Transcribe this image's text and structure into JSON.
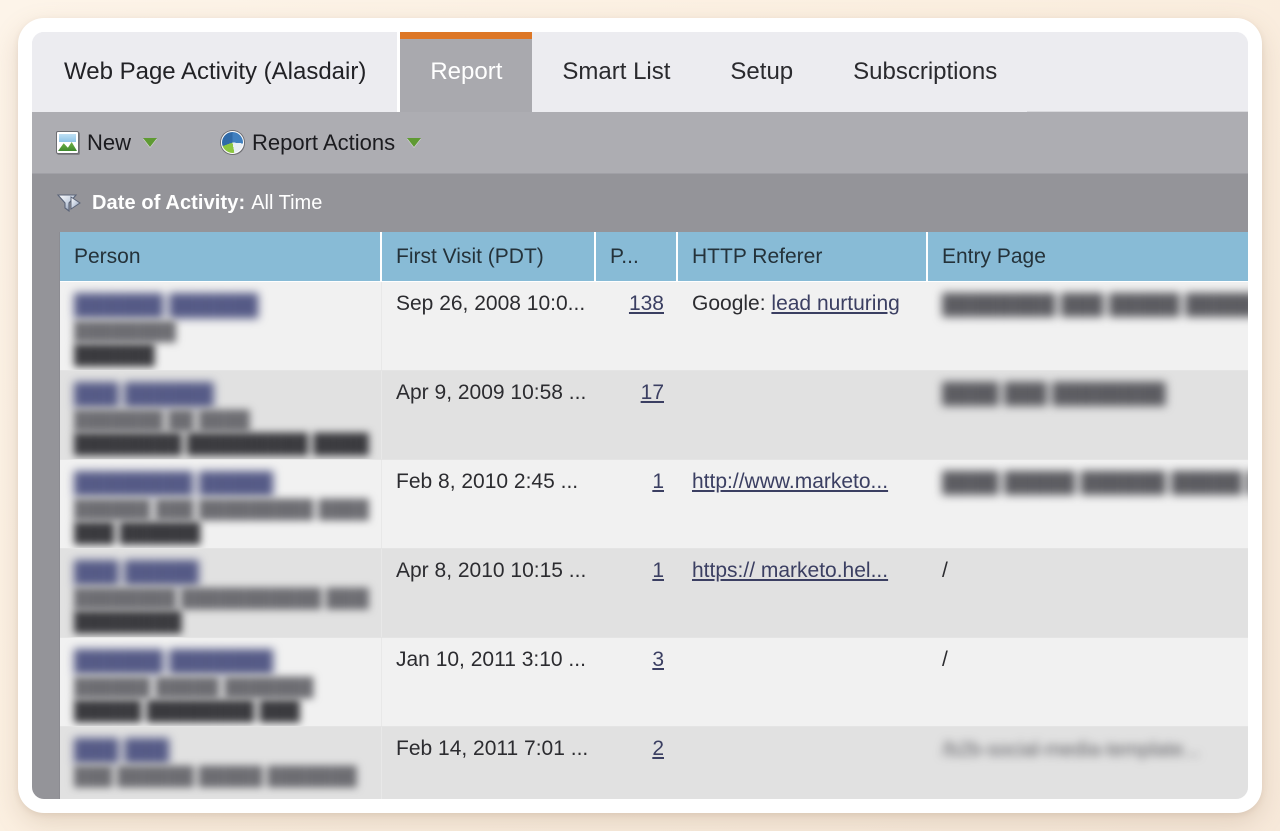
{
  "app": {
    "outer_background": "#fbf0e2",
    "accent_orange": "#dd7726",
    "header_blue": "#88bbd6",
    "link_color": "#3b3f62"
  },
  "tabs": [
    {
      "label": "Web Page Activity (Alasdair)",
      "active": false,
      "is_title": true
    },
    {
      "label": "Report",
      "active": true,
      "is_title": false
    },
    {
      "label": "Smart List",
      "active": false,
      "is_title": false
    },
    {
      "label": "Setup",
      "active": false,
      "is_title": false
    },
    {
      "label": "Subscriptions",
      "active": false,
      "is_title": false
    }
  ],
  "toolbar": {
    "buttons": [
      {
        "label": "New",
        "icon": "new-report-image-icon",
        "has_dropdown": true
      },
      {
        "label": "Report Actions",
        "icon": "pie-chart-icon",
        "has_dropdown": true
      }
    ]
  },
  "filter": {
    "icon": "funnel-filter-icon",
    "label": "Date of Activity:",
    "value": "All Time"
  },
  "grid": {
    "columns": [
      {
        "key": "person",
        "label": "Person"
      },
      {
        "key": "first_visit",
        "label": "First Visit (PDT)"
      },
      {
        "key": "page_views",
        "label": "P..."
      },
      {
        "key": "http_referer",
        "label": "HTTP Referer"
      },
      {
        "key": "entry_page",
        "label": "Entry Page"
      }
    ],
    "rows": [
      {
        "person": {
          "redacted": true,
          "name": "██████ ██████",
          "line2": "████████",
          "line3": "██████"
        },
        "first_visit": "Sep 26, 2008 10:0...",
        "page_views": "138",
        "page_views_link": true,
        "http_referer_prefix": "Google:",
        "http_referer_link": "lead nurturing",
        "entry_page": {
          "redacted": true,
          "text": "████████ ███ █████ █████..."
        }
      },
      {
        "person": {
          "redacted": true,
          "name": "███ ██████",
          "line2": "███████ ██ ████",
          "line3": "████████ █████████ ████████"
        },
        "first_visit": "Apr 9, 2009 10:58 ...",
        "page_views": "17",
        "page_views_link": true,
        "http_referer_prefix": "",
        "http_referer_link": "",
        "entry_page": {
          "redacted": true,
          "text": "████ ███ ████████"
        }
      },
      {
        "person": {
          "redacted": true,
          "name": "████████ █████",
          "line2": "██████ ███ █████████ ███████",
          "line3": "███ ██████"
        },
        "first_visit": "Feb 8, 2010 2:45 ...",
        "page_views": "1",
        "page_views_link": true,
        "http_referer_prefix": "",
        "http_referer_link": "http://www.marketo...",
        "entry_page": {
          "redacted": true,
          "text": "████ █████ ██████ █████ ████..."
        }
      },
      {
        "person": {
          "redacted": true,
          "name": "███ █████",
          "line2": "████████ ███████████ ████████",
          "line3": "████████"
        },
        "first_visit": "Apr 8, 2010 10:15 ...",
        "page_views": "1",
        "page_views_link": true,
        "http_referer_prefix": "",
        "http_referer_link": "https:// marketo.hel...",
        "entry_page": {
          "redacted": false,
          "text": "/"
        }
      },
      {
        "person": {
          "redacted": true,
          "name": "██████ ███████",
          "line2": "██████ █████ ███████",
          "line3": "█████ ████████ ███"
        },
        "first_visit": "Jan 10, 2011 3:10 ...",
        "page_views": "3",
        "page_views_link": true,
        "http_referer_prefix": "",
        "http_referer_link": "",
        "entry_page": {
          "redacted": false,
          "text": "/"
        }
      },
      {
        "person": {
          "redacted": true,
          "name": "███ ███",
          "line2": "███ ██████ █████ ███████",
          "line3": ""
        },
        "first_visit": "Feb 14, 2011 7:01 ...",
        "page_views": "2",
        "page_views_link": true,
        "http_referer_prefix": "",
        "http_referer_link": "",
        "entry_page": {
          "redacted": true,
          "text": "/b2b-social-media-template..."
        }
      }
    ]
  }
}
